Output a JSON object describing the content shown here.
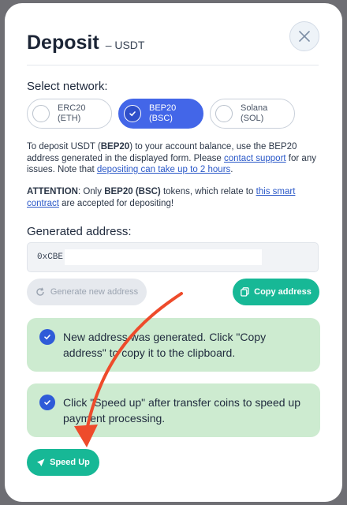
{
  "modal": {
    "title": "Deposit",
    "subtitle": "– USDT"
  },
  "network": {
    "label": "Select network:",
    "options": [
      {
        "name": "ERC20",
        "sub": "(ETH)",
        "selected": false
      },
      {
        "name": "BEP20",
        "sub": "(BSC)",
        "selected": true
      },
      {
        "name": "Solana",
        "sub": "(SOL)",
        "selected": false
      }
    ]
  },
  "info1": {
    "p1": "To deposit USDT (",
    "token": "BEP20",
    "p2": ") to your account balance, use the BEP20 address generated in the displayed form. Please ",
    "link1": "contact support",
    "p3": " for any issues. Note that ",
    "link2": "depositing can take up to 2 hours",
    "p4": "."
  },
  "info2": {
    "attention": "ATTENTION",
    "p1": ": Only ",
    "token": "BEP20 (BSC)",
    "p2": " tokens, which relate to ",
    "link": "this smart contract",
    "p3": " are accepted for depositing!"
  },
  "address": {
    "label": "Generated address:",
    "value": "0xCBE"
  },
  "buttons": {
    "generate": "Generate new address",
    "copy": "Copy address",
    "speed_up": "Speed Up"
  },
  "notices": {
    "n1": "New address was generated. Click \"Copy address\" to copy it to the clipboard.",
    "n2": "Click \"Speed up\" after transfer coins to speed up payment processing."
  },
  "colors": {
    "accent_blue": "#4366e8",
    "accent_green": "#17b896",
    "notice_bg": "#cdebd0",
    "arrow": "#ee4b2b"
  },
  "icons": {
    "close": "close-icon",
    "check": "check-icon",
    "refresh": "refresh-icon",
    "copy": "copy-icon",
    "rocket": "rocket-icon"
  }
}
